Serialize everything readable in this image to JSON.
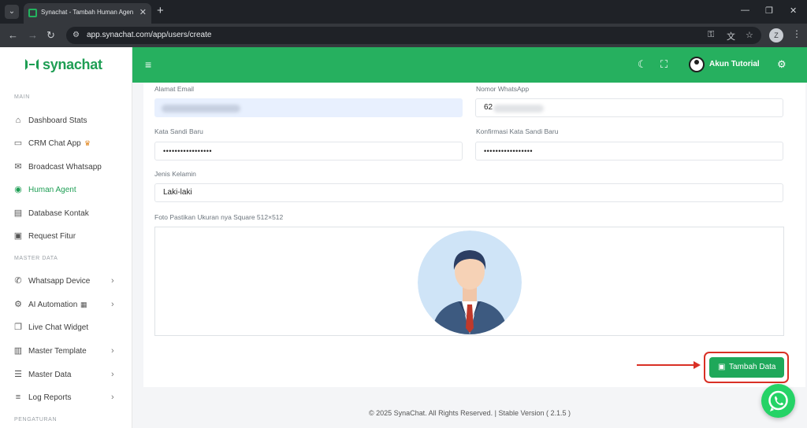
{
  "browser": {
    "tab_title": "Synachat - Tambah Human Agen",
    "url": "app.synachat.com/app/users/create",
    "profile_initial": "Z"
  },
  "brand": {
    "name": "synachat",
    "color": "#1e9e54"
  },
  "sidebar": {
    "sections": {
      "main": "MAIN",
      "master_data": "MASTER DATA",
      "pengaturan": "PENGATURAN"
    },
    "items": [
      {
        "label": "Dashboard Stats",
        "icon": "home-icon"
      },
      {
        "label": "CRM Chat App",
        "icon": "chat-icon",
        "badge_icon": "crown-icon"
      },
      {
        "label": "Broadcast Whatsapp",
        "icon": "mail-icon"
      },
      {
        "label": "Human Agent",
        "icon": "user-circle-icon",
        "active": true
      },
      {
        "label": "Database Kontak",
        "icon": "book-icon"
      },
      {
        "label": "Request Fitur",
        "icon": "clipboard-icon"
      },
      {
        "label": "Whatsapp Device",
        "icon": "whatsapp-icon",
        "has_submenu": true
      },
      {
        "label": "AI Automation",
        "icon": "robot-icon",
        "badge_icon": "robot-icon",
        "has_submenu": true
      },
      {
        "label": "Live Chat Widget",
        "icon": "widget-icon"
      },
      {
        "label": "Master Template",
        "icon": "template-icon",
        "has_submenu": true
      },
      {
        "label": "Master Data",
        "icon": "list-icon",
        "has_submenu": true
      },
      {
        "label": "Log Reports",
        "icon": "log-icon",
        "has_submenu": true
      }
    ]
  },
  "topbar": {
    "user_name": "Akun Tutorial",
    "icons": [
      "menu-icon",
      "moon-icon",
      "fullscreen-icon",
      "gear-icon"
    ],
    "color": "#26b05f"
  },
  "form": {
    "email": {
      "label": "Alamat Email",
      "value": ""
    },
    "whatsapp": {
      "label": "Nomor WhatsApp",
      "value": "62"
    },
    "password": {
      "label": "Kata Sandi Baru",
      "value": "•••••••••••••••••"
    },
    "password_confirm": {
      "label": "Konfirmasi Kata Sandi Baru",
      "value": "•••••••••••••••••"
    },
    "gender": {
      "label": "Jenis Kelamin",
      "value": "Laki-laki"
    },
    "photo": {
      "label": "Foto Pastikan Ukuran nya Square 512×512"
    },
    "submit_label": "Tambah Data",
    "submit_color": "#1ea85a",
    "highlight_color": "#d93025"
  },
  "footer": {
    "text": "© 2025 SynaChat. All Rights Reserved. | Stable Version ( 2.1.5 )"
  }
}
